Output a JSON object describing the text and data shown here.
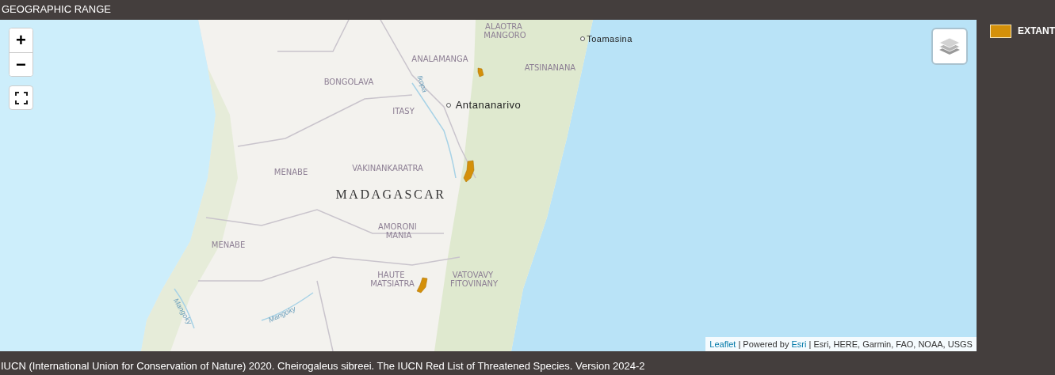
{
  "header": {
    "title": "GEOGRAPHIC RANGE"
  },
  "map": {
    "controls": [
      {
        "kind": "zoom-in",
        "label": "+"
      },
      {
        "kind": "zoom-out",
        "label": "−"
      },
      {
        "kind": "fullscreen"
      },
      {
        "kind": "layers"
      }
    ],
    "labels": [
      {
        "text": "ALAOTRA MANGORO",
        "kind": "region"
      },
      {
        "text": "Toamasina",
        "kind": "city"
      },
      {
        "text": "ANALAMANGA",
        "kind": "region"
      },
      {
        "text": "ATSINANANA",
        "kind": "region"
      },
      {
        "text": "BONGOLAVA",
        "kind": "region"
      },
      {
        "text": "Ikopa",
        "kind": "river"
      },
      {
        "text": "Antananarivo",
        "kind": "capital"
      },
      {
        "text": "ITASY",
        "kind": "region"
      },
      {
        "text": "MENABE",
        "kind": "region"
      },
      {
        "text": "VAKINANKARATRA",
        "kind": "region"
      },
      {
        "text": "MADAGASCAR",
        "kind": "country"
      },
      {
        "text": "AMORONI MANIA",
        "kind": "region"
      },
      {
        "text": "MENABE",
        "kind": "region"
      },
      {
        "text": "HAUTE MATSIATRA",
        "kind": "region"
      },
      {
        "text": "VATOVAVY FITOVINANY",
        "kind": "region"
      },
      {
        "text": "Mangoky",
        "kind": "river"
      },
      {
        "text": "Mangoky",
        "kind": "river"
      }
    ],
    "attribution": [
      {
        "text": "Leaflet",
        "kind": "link"
      },
      {
        "text": "| Powered by",
        "kind": "text"
      },
      {
        "text": "Esri",
        "kind": "link"
      },
      {
        "text": "| Esri, HERE, Garmin, FAO, NOAA, USGS",
        "kind": "text"
      }
    ]
  },
  "legend": [
    {
      "label": "EXTANT",
      "color": "#d4900a"
    }
  ],
  "citation": "IUCN (International Union for Conservation of Nature) 2020. Cheirogaleus sibreei. The IUCN Red List of Threatened Species. Version 2024-2"
}
